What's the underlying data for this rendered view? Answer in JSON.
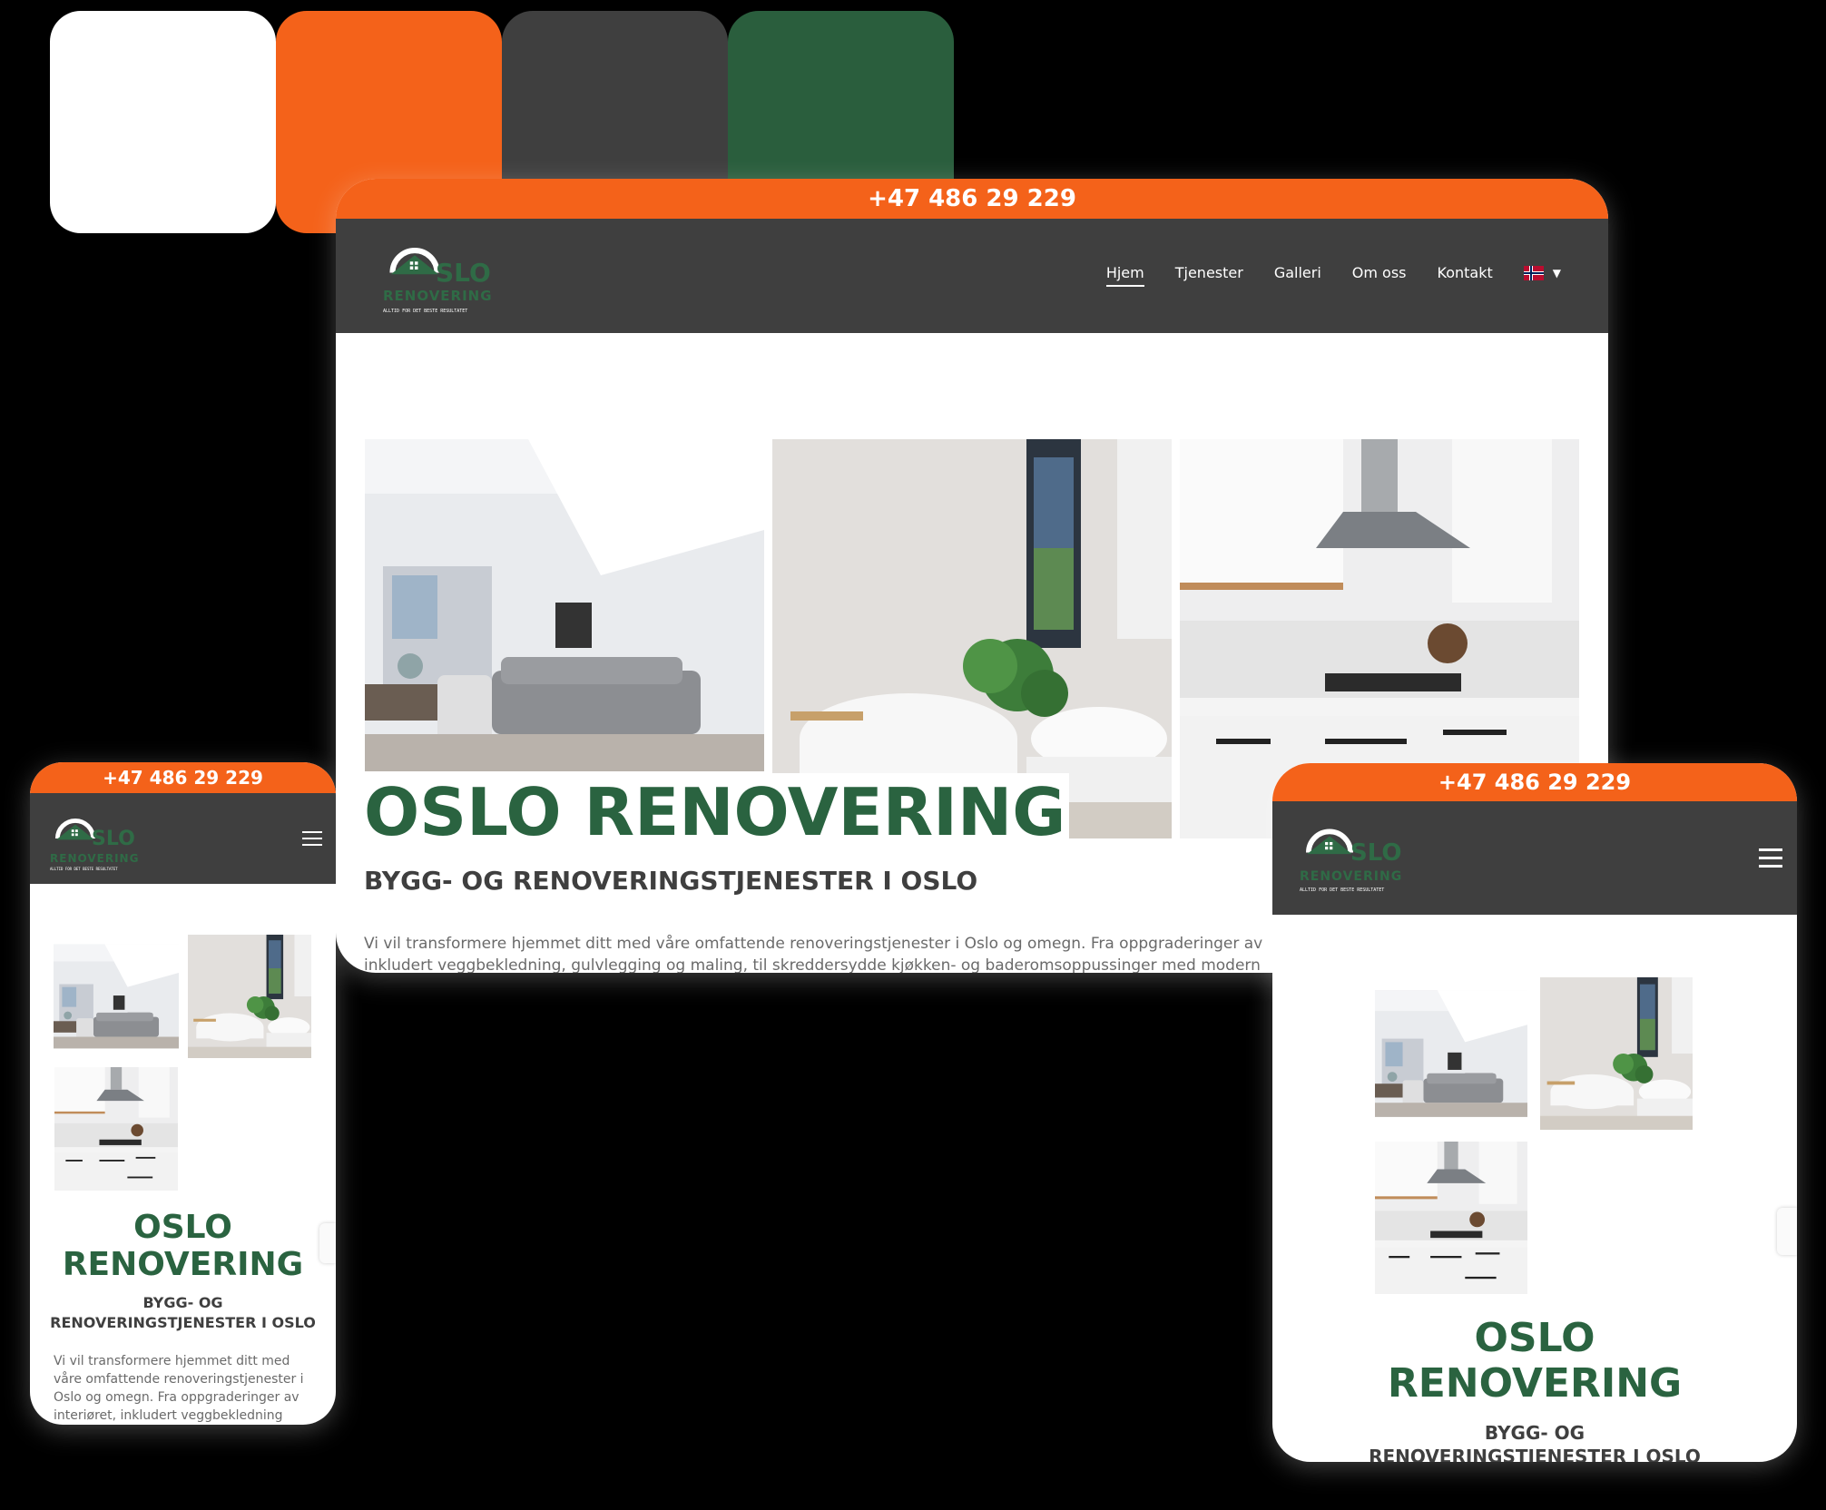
{
  "palette": {
    "swatches": [
      "#FFFFFF",
      "#F4621A",
      "#3F3F3F",
      "#2A5E3D"
    ],
    "swatch_names": [
      "white-swatch",
      "orange-swatch",
      "dark-gray-swatch",
      "green-swatch"
    ]
  },
  "site": {
    "phone": "+47 486 29 229",
    "logo_word": "SLO",
    "logo_sub": "RENOVERING",
    "logo_tagline": "ALLTID FOR DET BESTE RESULTATET",
    "nav": [
      "Hjem",
      "Tjenester",
      "Galleri",
      "Om oss",
      "Kontakt"
    ],
    "title": "OSLO RENOVERING",
    "title_line1": "OSLO",
    "title_line2": "RENOVERING",
    "subtitle": "BYGG- OG RENOVERINGSTJENESTER I OSLO",
    "subtitle_line1": "BYGG- OG",
    "subtitle_line2": "RENOVERINGSTJENESTER I OSLO",
    "paragraph_desktop_line1": "Vi vil transformere hjemmet ditt med våre omfattende renoveringstjenester i Oslo og omegn. Fra oppgraderinger av",
    "paragraph_desktop_line2": "inkludert veggbekledning, gulvlegging og maling, til skreddersydde kjøkken- og baderomsoppussinger med modern",
    "paragraph_mobile_lines": [
      "Vi vil transformere hjemmet ditt med",
      "våre omfattende renoveringstjenester i",
      "Oslo og omegn. Fra oppgraderinger av",
      "interiøret, inkludert veggbekledning"
    ]
  },
  "colors": {
    "orange": "#F4621A",
    "dark": "#3F3F3F",
    "green": "#2A6340"
  }
}
